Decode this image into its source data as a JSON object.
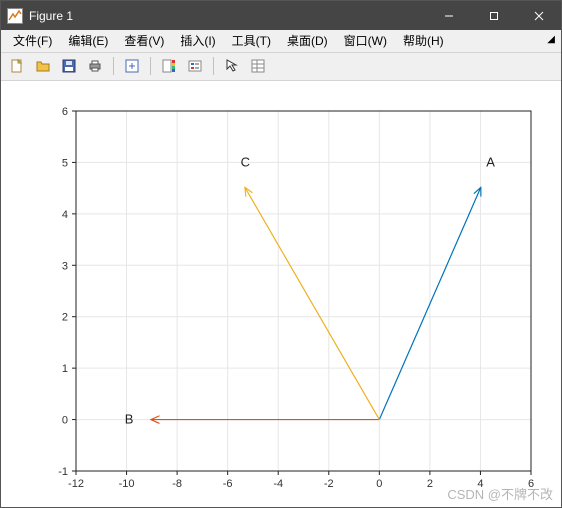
{
  "window": {
    "title": "Figure 1"
  },
  "menubar": {
    "items": [
      {
        "label": "文件(F)"
      },
      {
        "label": "编辑(E)"
      },
      {
        "label": "查看(V)"
      },
      {
        "label": "插入(I)"
      },
      {
        "label": "工具(T)"
      },
      {
        "label": "桌面(D)"
      },
      {
        "label": "窗口(W)"
      },
      {
        "label": "帮助(H)"
      }
    ]
  },
  "toolbar": {
    "buttons": [
      "new-figure",
      "open-file",
      "save-figure",
      "print-figure",
      "sep",
      "link-brush",
      "sep",
      "insert-colorbar",
      "insert-legend",
      "sep",
      "edit-plot",
      "open-property-inspector"
    ]
  },
  "chart_data": {
    "type": "quiver",
    "origin": [
      0,
      0
    ],
    "series": [
      {
        "name": "A",
        "vector": [
          4,
          4.5
        ],
        "color": "#0072BD",
        "label_pos": [
          4.4,
          5.0
        ]
      },
      {
        "name": "B",
        "vector": [
          -9,
          0
        ],
        "color": "#D95319",
        "label_pos": [
          -9.9,
          0.0
        ]
      },
      {
        "name": "C",
        "vector": [
          -5.3,
          4.5
        ],
        "color": "#EDB120",
        "label_pos": [
          -5.3,
          5.0
        ]
      }
    ],
    "xlabel": "",
    "ylabel": "",
    "title": "",
    "xlim": [
      -12,
      6
    ],
    "ylim": [
      -1,
      6
    ],
    "xticks": [
      -12,
      -10,
      -8,
      -6,
      -4,
      -2,
      0,
      2,
      4,
      6
    ],
    "yticks": [
      -1,
      0,
      1,
      2,
      3,
      4,
      5,
      6
    ],
    "grid": true
  },
  "watermark": "CSDN @不牌不改"
}
